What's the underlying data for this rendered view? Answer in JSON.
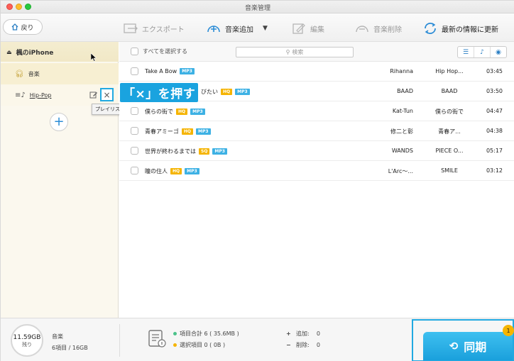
{
  "window": {
    "title": "音楽管理"
  },
  "toolbar": {
    "back_label": "戻り",
    "export_label": "エクスポート",
    "add_music_label": "音楽追加",
    "edit_label": "編集",
    "delete_label": "音楽削除",
    "refresh_label": "最新の情報に更新"
  },
  "sidebar": {
    "device_name": "楓のiPhone",
    "music_label": "音楽",
    "playlist_label": "Hip-Pop",
    "tooltip": "プレイリスト編集"
  },
  "callout": {
    "text": "「×」を押す"
  },
  "list": {
    "select_all_label": "すべてを選択する",
    "search_placeholder": "検索",
    "songs": [
      {
        "title": "Take A Bow",
        "badges": [
          "MP3"
        ],
        "artist": "Rihanna",
        "album": "Hip Hop...",
        "duration": "03:45"
      },
      {
        "title": "びたい",
        "badges": [
          "HQ",
          "MP3"
        ],
        "artist": "BAAD",
        "album": "BAAD",
        "duration": "03:50"
      },
      {
        "title": "僕らの街で",
        "badges": [
          "HQ",
          "MP3"
        ],
        "artist": "Kat-Tun",
        "album": "僕らの街で",
        "duration": "04:47"
      },
      {
        "title": "青春アミーゴ",
        "badges": [
          "HQ",
          "MP3"
        ],
        "artist": "修二と彰",
        "album": "青春ア...",
        "duration": "04:38"
      },
      {
        "title": "世界が終わるまでは",
        "badges": [
          "SQ",
          "MP3"
        ],
        "artist": "WANDS",
        "album": "PIECE O...",
        "duration": "05:17"
      },
      {
        "title": "瞳の住人",
        "badges": [
          "HQ",
          "MP3"
        ],
        "artist": "L'Arc～...",
        "album": "SMILE",
        "duration": "03:12"
      }
    ]
  },
  "footer": {
    "storage_free": "11.59GB",
    "storage_left_label": "残り",
    "media_label": "音楽",
    "media_count": "6項目 / 16GB",
    "total_items": "項目合計 6 ( 35.6MB )",
    "selected_items": "選択項目 0 ( 0B )",
    "added_label": "追加:",
    "added_count": "0",
    "deleted_label": "削除:",
    "deleted_count": "0",
    "sync_label": "同期",
    "sync_badge": "1"
  },
  "colors": {
    "accent": "#21a9e1",
    "mp3_badge": "#3db1e4",
    "hq_badge": "#f5b400",
    "sidebar_bg": "#fbf8ee"
  }
}
